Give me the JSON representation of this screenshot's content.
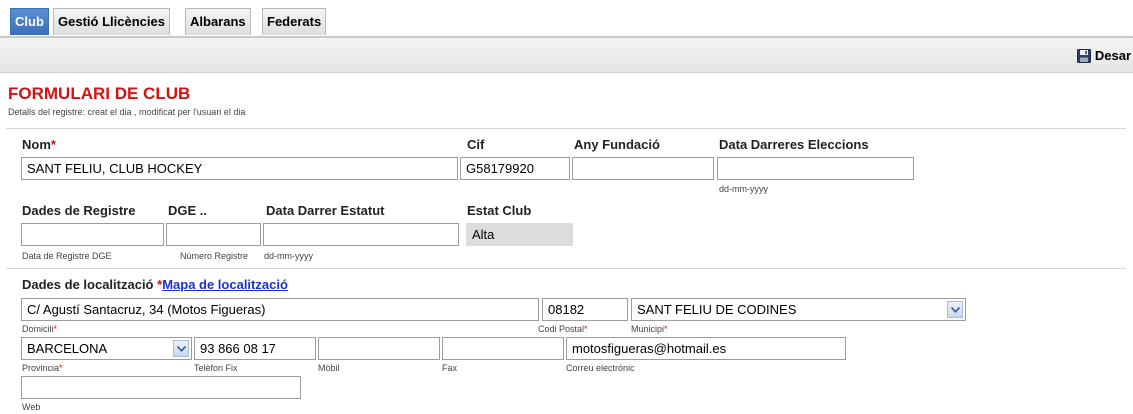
{
  "tabs": [
    {
      "label": "Club",
      "active": true
    },
    {
      "label": "Gestió Llicències",
      "active": false
    },
    {
      "label": "Albarans",
      "active": false
    },
    {
      "label": "Federats",
      "active": false
    }
  ],
  "toolbar": {
    "save_label": "Desar",
    "save_icon": "floppy-disk-icon"
  },
  "form": {
    "title": "FORMULARI DE CLUB",
    "subtitle": "Detalls del registre: creat el dia , modificat per l'usuari el dia",
    "required_mark": "*",
    "nom": {
      "label": "Nom",
      "value": "SANT FELIU, CLUB HOCKEY"
    },
    "cif": {
      "label": "Cif",
      "value": "G58179920"
    },
    "any_fundacio": {
      "label": "Any Fundació",
      "value": ""
    },
    "data_eleccions": {
      "label": "Data Darreres Eleccions",
      "value": "",
      "hint": "dd-mm-yyyy"
    },
    "dades_registre": {
      "label": "Dades de Registre",
      "value": "",
      "hint": "Data de Registre DGE"
    },
    "dge": {
      "label": "DGE ..",
      "value": "",
      "hint": "Número Registre"
    },
    "data_estatut": {
      "label": "Data Darrer Estatut",
      "value": "",
      "hint": "dd-mm-yyyy"
    },
    "estat_club": {
      "label": "Estat Club",
      "value": "Alta"
    },
    "localitzacio": {
      "label": "Dades de localització",
      "link": "Mapa de localització"
    },
    "domicili": {
      "label": "Domicili",
      "value": "C/ Agustí Santacruz, 34 (Motos Figueras)"
    },
    "codi_postal": {
      "label": "Codi Postal",
      "value": "08182"
    },
    "municipi": {
      "label": "Municipi",
      "value": "SANT FELIU DE CODINES"
    },
    "provincia": {
      "label": "Provincia",
      "value": "BARCELONA"
    },
    "telefon_fix": {
      "label": "Telèfon Fix",
      "value": "93 866 08 17"
    },
    "mobil": {
      "label": "Mòbil",
      "value": ""
    },
    "fax": {
      "label": "Fax",
      "value": ""
    },
    "correu": {
      "label": "Correu electrònic",
      "value": "motosfigueras@hotmail.es"
    },
    "web": {
      "label": "Web",
      "value": ""
    }
  }
}
